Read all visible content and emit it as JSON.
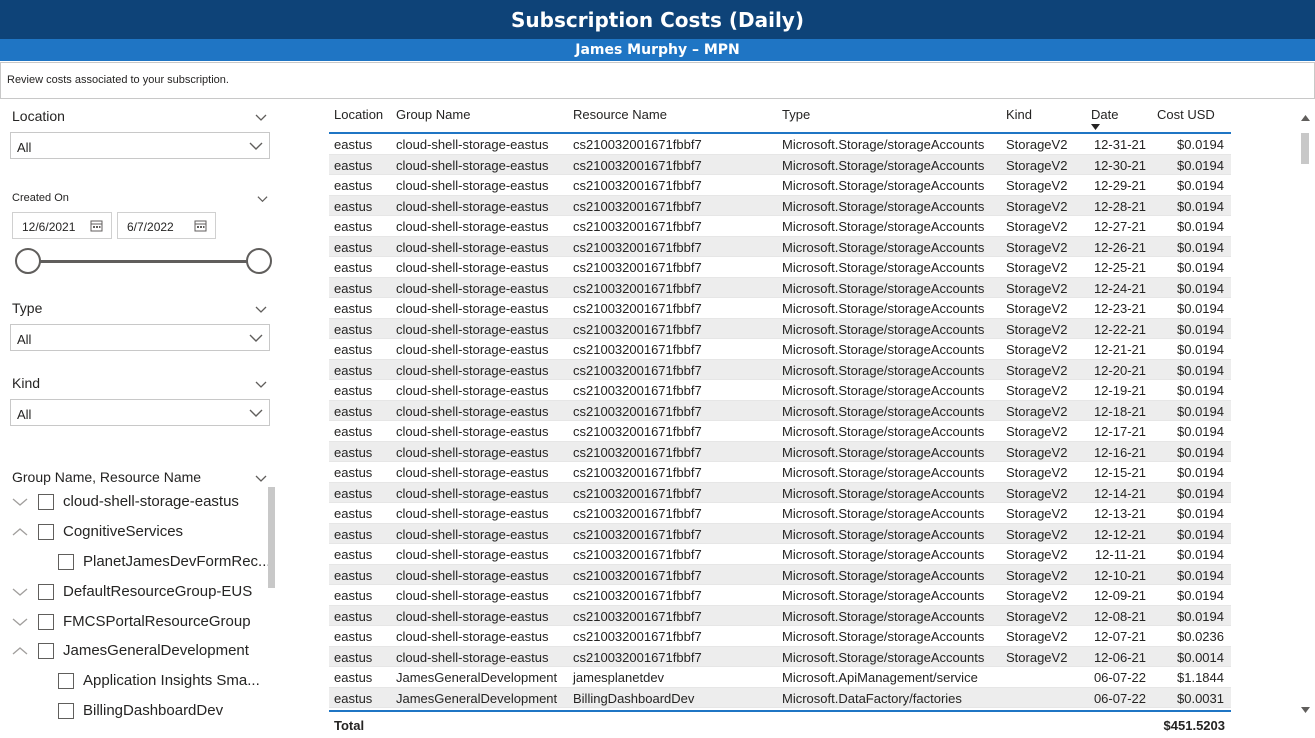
{
  "header": {
    "title": "Subscription Costs (Daily)",
    "subtitle": "James Murphy – MPN",
    "description": "Review costs associated to your subscription."
  },
  "slicers": {
    "location": {
      "label": "Location",
      "value": "All"
    },
    "created_on": {
      "label": "Created On",
      "start": "12/6/2021",
      "end": "6/7/2022"
    },
    "type": {
      "label": "Type",
      "value": "All"
    },
    "kind": {
      "label": "Kind",
      "value": "All"
    },
    "hierarchy": {
      "label": "Group Name, Resource Name",
      "items": [
        {
          "label": "cloud-shell-storage-eastus",
          "expanded": false,
          "level": 0
        },
        {
          "label": "CognitiveServices",
          "expanded": true,
          "level": 0
        },
        {
          "label": "PlanetJamesDevFormRec...",
          "level": 1
        },
        {
          "label": "DefaultResourceGroup-EUS",
          "expanded": false,
          "level": 0
        },
        {
          "label": "FMCSPortalResourceGroup",
          "expanded": false,
          "level": 0
        },
        {
          "label": "JamesGeneralDevelopment",
          "expanded": true,
          "level": 0
        },
        {
          "label": "Application Insights Sma...",
          "level": 1
        },
        {
          "label": "BillingDashboardDev",
          "level": 1
        }
      ]
    }
  },
  "table": {
    "columns": [
      "Location",
      "Group Name",
      "Resource Name",
      "Type",
      "Kind",
      "Date",
      "Cost USD"
    ],
    "rows": [
      [
        "eastus",
        "cloud-shell-storage-eastus",
        "cs210032001671fbbf7",
        "Microsoft.Storage/storageAccounts",
        "StorageV2",
        "12-31-21",
        "$0.0194"
      ],
      [
        "eastus",
        "cloud-shell-storage-eastus",
        "cs210032001671fbbf7",
        "Microsoft.Storage/storageAccounts",
        "StorageV2",
        "12-30-21",
        "$0.0194"
      ],
      [
        "eastus",
        "cloud-shell-storage-eastus",
        "cs210032001671fbbf7",
        "Microsoft.Storage/storageAccounts",
        "StorageV2",
        "12-29-21",
        "$0.0194"
      ],
      [
        "eastus",
        "cloud-shell-storage-eastus",
        "cs210032001671fbbf7",
        "Microsoft.Storage/storageAccounts",
        "StorageV2",
        "12-28-21",
        "$0.0194"
      ],
      [
        "eastus",
        "cloud-shell-storage-eastus",
        "cs210032001671fbbf7",
        "Microsoft.Storage/storageAccounts",
        "StorageV2",
        "12-27-21",
        "$0.0194"
      ],
      [
        "eastus",
        "cloud-shell-storage-eastus",
        "cs210032001671fbbf7",
        "Microsoft.Storage/storageAccounts",
        "StorageV2",
        "12-26-21",
        "$0.0194"
      ],
      [
        "eastus",
        "cloud-shell-storage-eastus",
        "cs210032001671fbbf7",
        "Microsoft.Storage/storageAccounts",
        "StorageV2",
        "12-25-21",
        "$0.0194"
      ],
      [
        "eastus",
        "cloud-shell-storage-eastus",
        "cs210032001671fbbf7",
        "Microsoft.Storage/storageAccounts",
        "StorageV2",
        "12-24-21",
        "$0.0194"
      ],
      [
        "eastus",
        "cloud-shell-storage-eastus",
        "cs210032001671fbbf7",
        "Microsoft.Storage/storageAccounts",
        "StorageV2",
        "12-23-21",
        "$0.0194"
      ],
      [
        "eastus",
        "cloud-shell-storage-eastus",
        "cs210032001671fbbf7",
        "Microsoft.Storage/storageAccounts",
        "StorageV2",
        "12-22-21",
        "$0.0194"
      ],
      [
        "eastus",
        "cloud-shell-storage-eastus",
        "cs210032001671fbbf7",
        "Microsoft.Storage/storageAccounts",
        "StorageV2",
        "12-21-21",
        "$0.0194"
      ],
      [
        "eastus",
        "cloud-shell-storage-eastus",
        "cs210032001671fbbf7",
        "Microsoft.Storage/storageAccounts",
        "StorageV2",
        "12-20-21",
        "$0.0194"
      ],
      [
        "eastus",
        "cloud-shell-storage-eastus",
        "cs210032001671fbbf7",
        "Microsoft.Storage/storageAccounts",
        "StorageV2",
        "12-19-21",
        "$0.0194"
      ],
      [
        "eastus",
        "cloud-shell-storage-eastus",
        "cs210032001671fbbf7",
        "Microsoft.Storage/storageAccounts",
        "StorageV2",
        "12-18-21",
        "$0.0194"
      ],
      [
        "eastus",
        "cloud-shell-storage-eastus",
        "cs210032001671fbbf7",
        "Microsoft.Storage/storageAccounts",
        "StorageV2",
        "12-17-21",
        "$0.0194"
      ],
      [
        "eastus",
        "cloud-shell-storage-eastus",
        "cs210032001671fbbf7",
        "Microsoft.Storage/storageAccounts",
        "StorageV2",
        "12-16-21",
        "$0.0194"
      ],
      [
        "eastus",
        "cloud-shell-storage-eastus",
        "cs210032001671fbbf7",
        "Microsoft.Storage/storageAccounts",
        "StorageV2",
        "12-15-21",
        "$0.0194"
      ],
      [
        "eastus",
        "cloud-shell-storage-eastus",
        "cs210032001671fbbf7",
        "Microsoft.Storage/storageAccounts",
        "StorageV2",
        "12-14-21",
        "$0.0194"
      ],
      [
        "eastus",
        "cloud-shell-storage-eastus",
        "cs210032001671fbbf7",
        "Microsoft.Storage/storageAccounts",
        "StorageV2",
        "12-13-21",
        "$0.0194"
      ],
      [
        "eastus",
        "cloud-shell-storage-eastus",
        "cs210032001671fbbf7",
        "Microsoft.Storage/storageAccounts",
        "StorageV2",
        "12-12-21",
        "$0.0194"
      ],
      [
        "eastus",
        "cloud-shell-storage-eastus",
        "cs210032001671fbbf7",
        "Microsoft.Storage/storageAccounts",
        "StorageV2",
        "12-11-21",
        "$0.0194"
      ],
      [
        "eastus",
        "cloud-shell-storage-eastus",
        "cs210032001671fbbf7",
        "Microsoft.Storage/storageAccounts",
        "StorageV2",
        "12-10-21",
        "$0.0194"
      ],
      [
        "eastus",
        "cloud-shell-storage-eastus",
        "cs210032001671fbbf7",
        "Microsoft.Storage/storageAccounts",
        "StorageV2",
        "12-09-21",
        "$0.0194"
      ],
      [
        "eastus",
        "cloud-shell-storage-eastus",
        "cs210032001671fbbf7",
        "Microsoft.Storage/storageAccounts",
        "StorageV2",
        "12-08-21",
        "$0.0194"
      ],
      [
        "eastus",
        "cloud-shell-storage-eastus",
        "cs210032001671fbbf7",
        "Microsoft.Storage/storageAccounts",
        "StorageV2",
        "12-07-21",
        "$0.0236"
      ],
      [
        "eastus",
        "cloud-shell-storage-eastus",
        "cs210032001671fbbf7",
        "Microsoft.Storage/storageAccounts",
        "StorageV2",
        "12-06-21",
        "$0.0014"
      ],
      [
        "eastus",
        "JamesGeneralDevelopment",
        "jamesplanetdev",
        "Microsoft.ApiManagement/service",
        "",
        "06-07-22",
        "$1.1844"
      ],
      [
        "eastus",
        "JamesGeneralDevelopment",
        "BillingDashboardDev",
        "Microsoft.DataFactory/factories",
        "",
        "06-07-22",
        "$0.0031"
      ]
    ],
    "total_label": "Total",
    "total_value": "$451.5203"
  }
}
